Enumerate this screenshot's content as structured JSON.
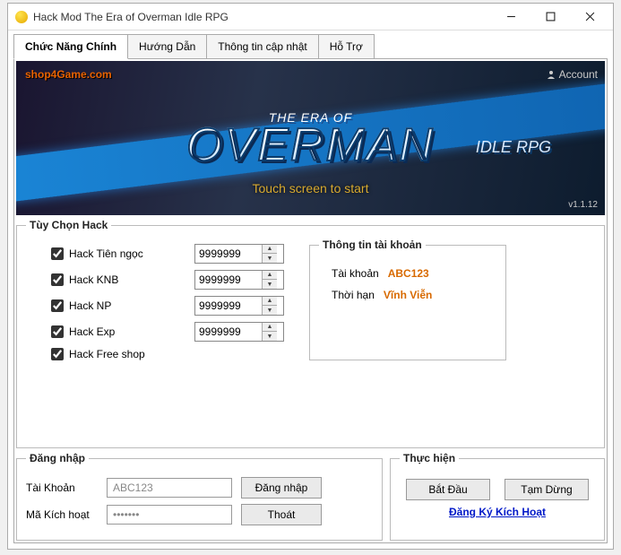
{
  "window": {
    "title": "Hack Mod The Era of Overman Idle RPG"
  },
  "tabs": [
    "Chức Năng Chính",
    "Hướng Dẫn",
    "Thông tin cập nhật",
    "Hỗ Trợ"
  ],
  "banner": {
    "watermark": "shop4Game.com",
    "line1": "THE ERA OF",
    "line2": "OVERMAN",
    "line3": "IDLE RPG",
    "touch": "Touch screen to start",
    "version": "v1.1.12",
    "account_btn": "Account"
  },
  "options": {
    "legend": "Tùy Chọn Hack",
    "items": [
      {
        "label": "Hack Tiên ngọc",
        "value": "9999999",
        "spinner": true
      },
      {
        "label": "Hack KNB",
        "value": "9999999",
        "spinner": true
      },
      {
        "label": "Hack NP",
        "value": "9999999",
        "spinner": true
      },
      {
        "label": "Hack Exp",
        "value": "9999999",
        "spinner": true
      },
      {
        "label": "Hack Free shop",
        "value": "",
        "spinner": false
      }
    ]
  },
  "acctinfo": {
    "legend": "Thông tin tài khoản",
    "acct_label": "Tài khoản",
    "acct_value": "ABC123",
    "dur_label": "Thời hạn",
    "dur_value": "Vĩnh Viễn"
  },
  "login": {
    "legend": "Đăng nhập",
    "acct_label": "Tài Khoản",
    "acct_value": "ABC123",
    "key_label": "Mã Kích hoạt",
    "key_value": "•••••••",
    "btn_login": "Đăng nhập",
    "btn_exit": "Thoát"
  },
  "exec": {
    "legend": "Thực hiện",
    "btn_start": "Bắt Đầu",
    "btn_pause": "Tạm Dừng",
    "link": "Đăng Ký Kích Hoạt"
  }
}
